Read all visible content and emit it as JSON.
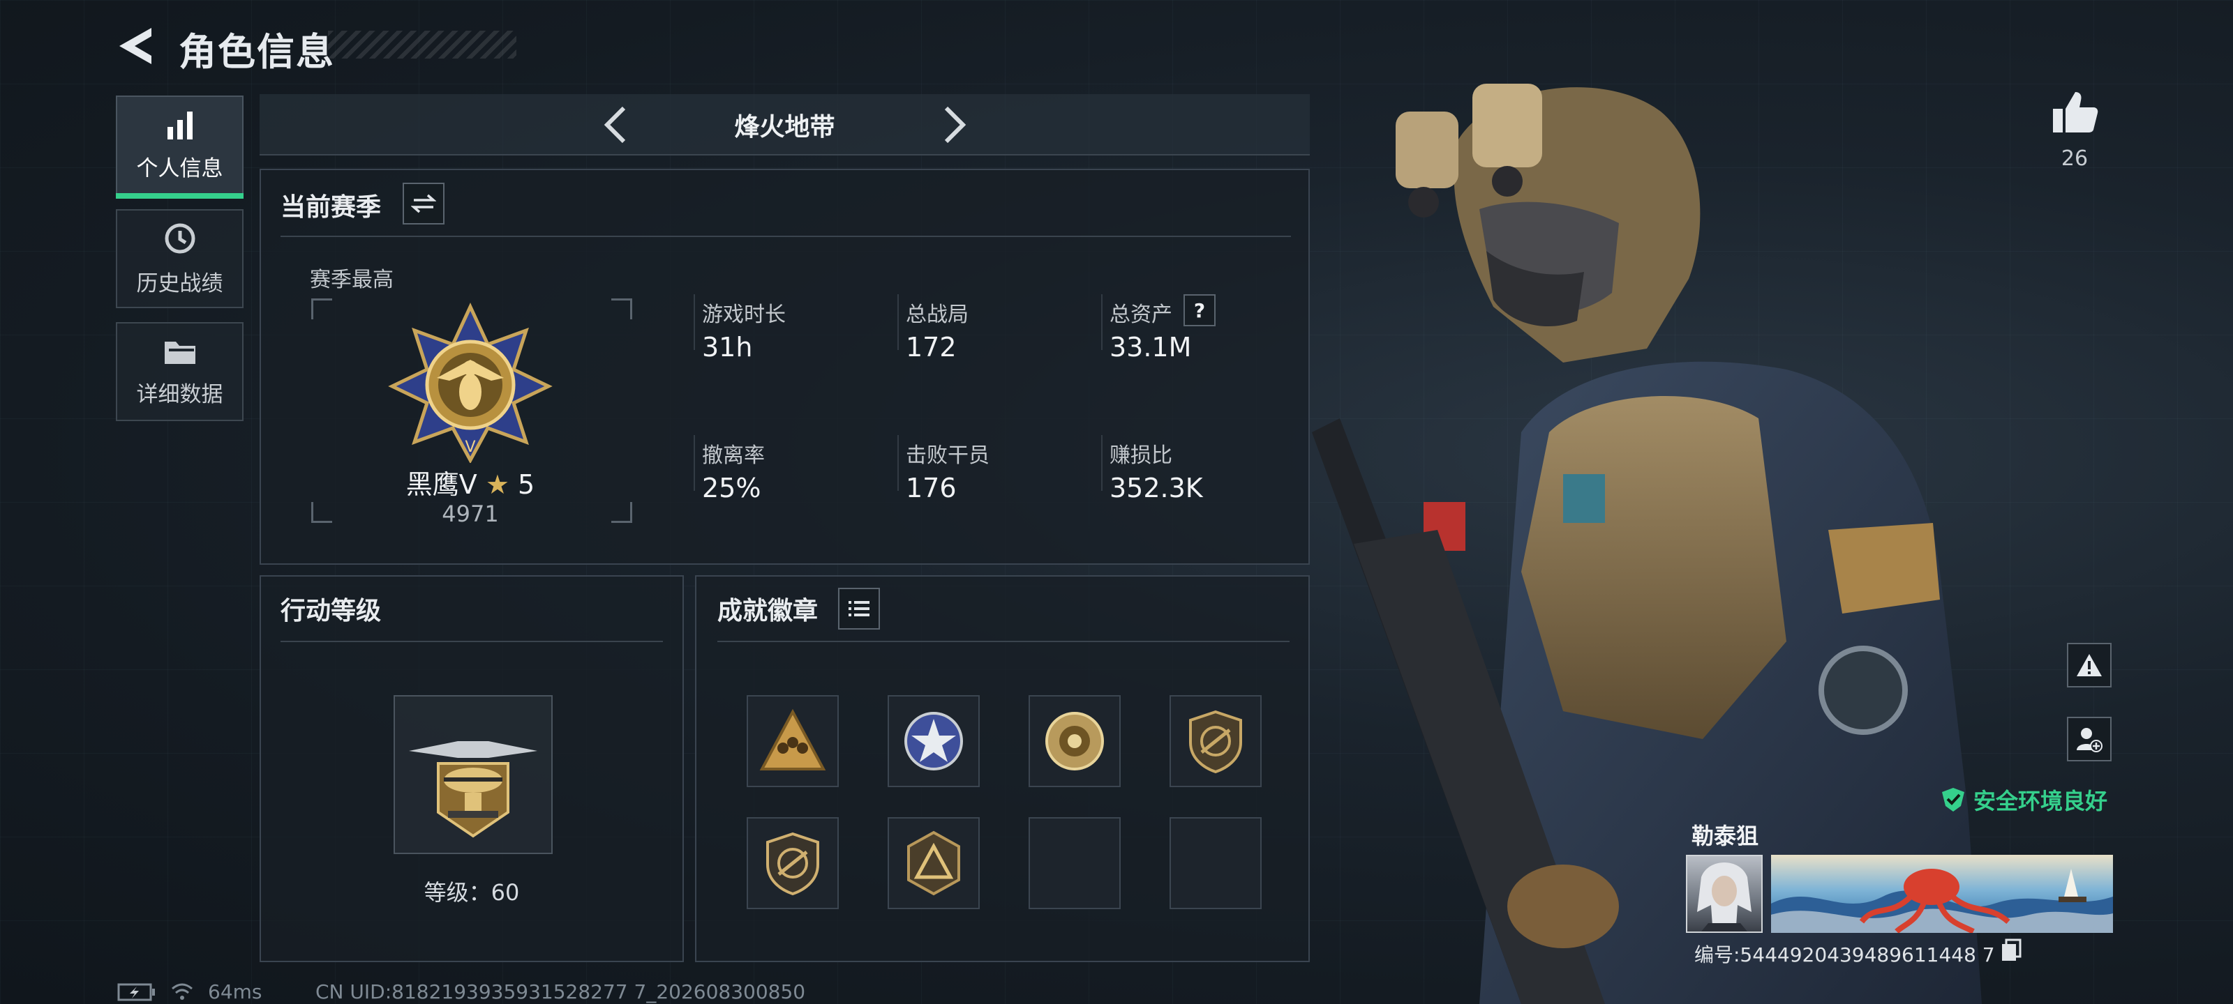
{
  "header": {
    "title": "角色信息"
  },
  "nav": [
    {
      "label": "个人信息",
      "icon": "bar-chart-icon",
      "active": true
    },
    {
      "label": "历史战绩",
      "icon": "history-clock-icon",
      "active": false
    },
    {
      "label": "详细数据",
      "icon": "folder-icon",
      "active": false
    }
  ],
  "mode": {
    "name": "烽火地带"
  },
  "season": {
    "title": "当前赛季",
    "best_label": "赛季最高",
    "rank_name": "黑鹰Ⅴ",
    "rank_stars": "5",
    "rank_points": "4971",
    "stats": [
      {
        "label": "游戏时长",
        "value": "31h"
      },
      {
        "label": "总战局",
        "value": "172"
      },
      {
        "label": "总资产",
        "value": "33.1M",
        "help": "?"
      },
      {
        "label": "撤离率",
        "value": "25%"
      },
      {
        "label": "击败干员",
        "value": "176"
      },
      {
        "label": "赚损比",
        "value": "352.3K"
      }
    ]
  },
  "action_level": {
    "title": "行动等级",
    "level_text": "等级：60"
  },
  "achievements": {
    "title": "成就徽章",
    "badges": [
      "soldiers-badge-icon",
      "star-wheel-badge-icon",
      "ornate-medal-icon",
      "gun-shield-badge-icon",
      "gun-shield-badge-2-icon",
      "triangle-shield-badge-icon",
      "empty-slot",
      "empty-slot"
    ]
  },
  "footer": {
    "ping": "64ms",
    "uid": "CN UID:8182193935931528277 7_202608300850"
  },
  "right": {
    "likes": "26",
    "env_status": "安全环境良好",
    "player_name": "勒泰狙",
    "player_id": "编号:5444920439489611448 7"
  },
  "colors": {
    "accent": "#35d08c",
    "panel_border": "#3a4450",
    "text": "#d8dde2"
  }
}
